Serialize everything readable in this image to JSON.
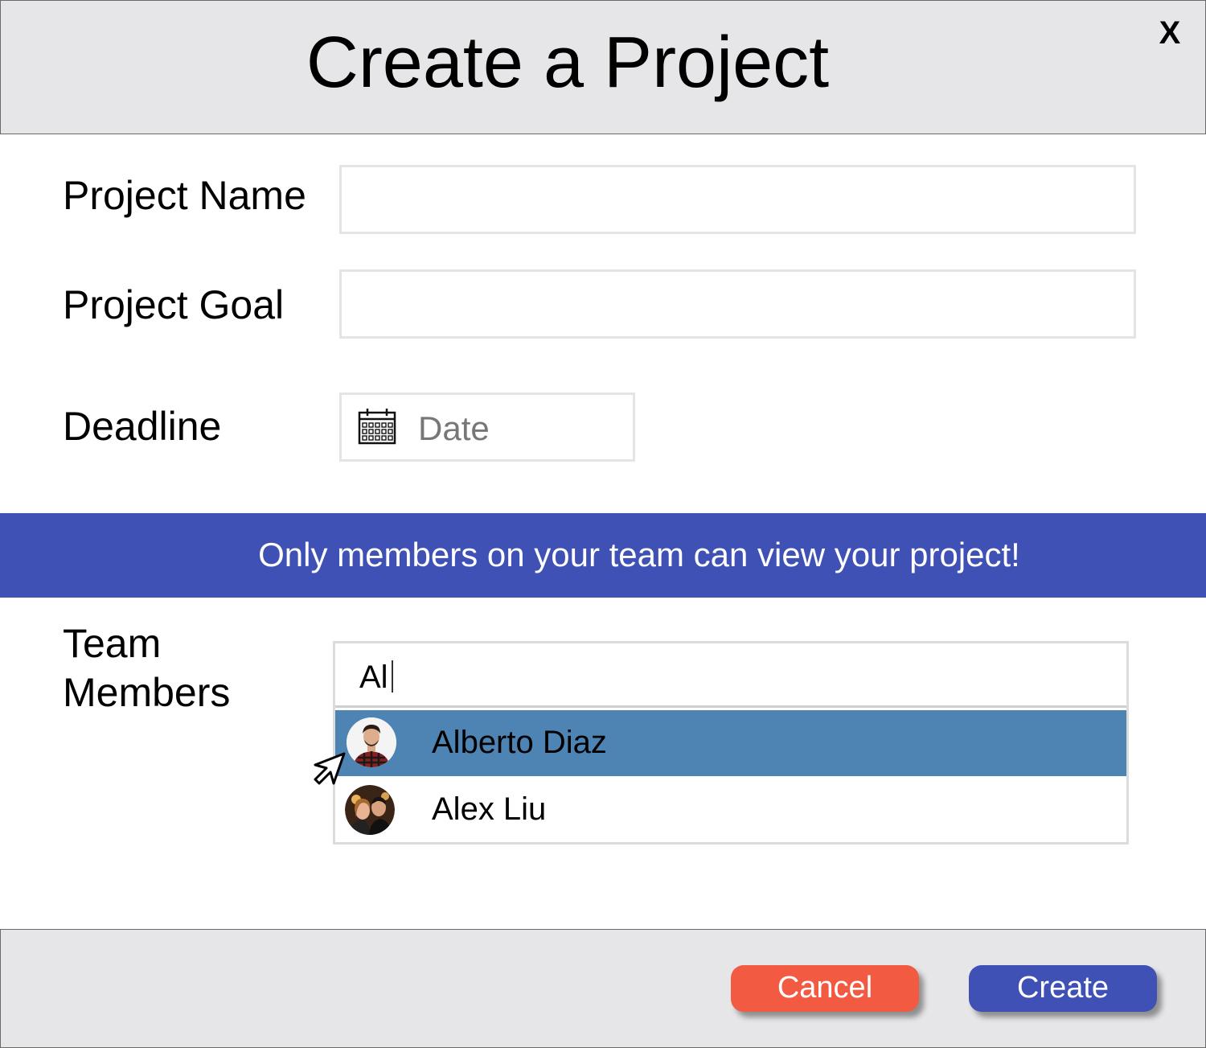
{
  "dialog": {
    "title": "Create a Project",
    "close_label": "X"
  },
  "form": {
    "project_name_label": "Project Name",
    "project_name_value": "",
    "project_goal_label": "Project Goal",
    "project_goal_value": "",
    "deadline_label": "Deadline",
    "deadline_placeholder": "Date"
  },
  "banner": {
    "text": "Only members on your team can view your project!"
  },
  "team": {
    "label_line1": "Team",
    "label_line2": "Members",
    "search_value": "Al",
    "suggestions": [
      {
        "name": "Alberto Diaz",
        "selected": true
      },
      {
        "name": "Alex Liu",
        "selected": false
      }
    ]
  },
  "footer": {
    "cancel_label": "Cancel",
    "create_label": "Create"
  },
  "colors": {
    "accent": "#3f51b5",
    "cancel": "#f25a42",
    "selected_row": "#4e84b4",
    "header_bg": "#e6e6e8"
  },
  "icons": [
    "close-icon",
    "calendar-icon",
    "mouse-pointer-icon",
    "avatar"
  ]
}
